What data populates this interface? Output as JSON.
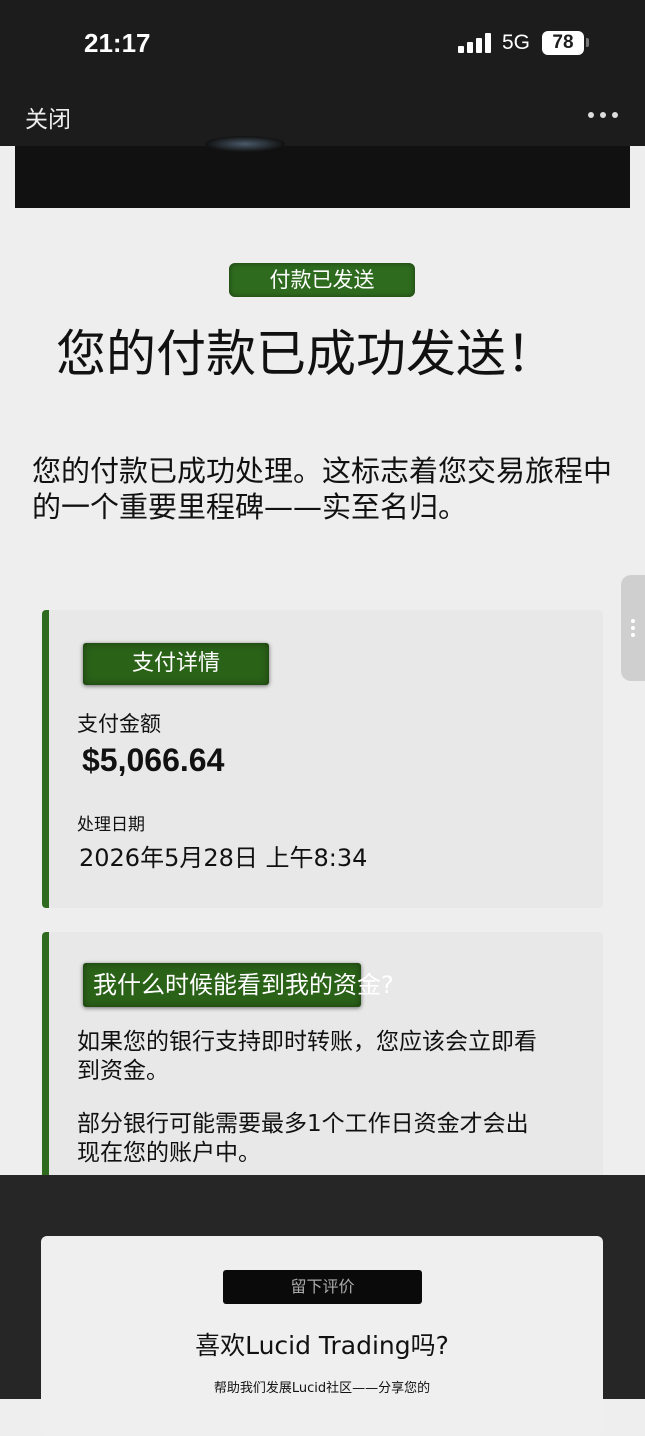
{
  "status_bar": {
    "time": "21:17",
    "network": "5G",
    "battery": "78"
  },
  "nav": {
    "close_label": "关闭"
  },
  "status_pill": "付款已发送",
  "title": "您的付款已成功发送！",
  "intro": "您的付款已成功处理。这标志着您交易旅程中的一个重要里程碑——实至名归。",
  "payment_details": {
    "badge": "支付详情",
    "amount_label": "支付金额",
    "amount": "$5,066.64",
    "date_label": "处理日期",
    "date": "2026年5月28日 上午8:34"
  },
  "funds_info": {
    "badge": "我什么时候能看到我的资金?",
    "para1": "如果您的银行支持即时转账，您应该会立即看到资金。",
    "para2": "部分银行可能需要最多1个工作日资金才会出现在您的账户中。"
  },
  "review": {
    "button": "留下评价",
    "title": "喜欢Lucid Trading吗?",
    "subtitle": "帮助我们发展Lucid社区——分享您的"
  },
  "colors": {
    "accent_green": "#2e6b1e",
    "dark": "#1c1c1c"
  },
  "icons": [
    "signal-icon",
    "battery-icon",
    "more-icon",
    "side-handle-icon"
  ]
}
